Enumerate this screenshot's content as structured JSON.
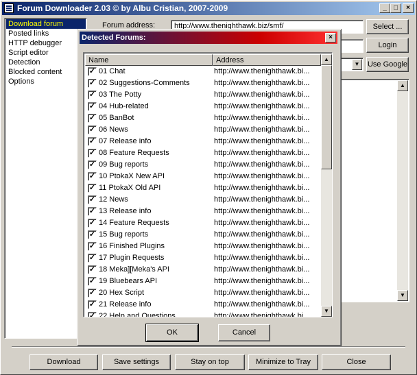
{
  "window": {
    "title": "Forum Downloader 2.03 © by Albu Cristian, 2007-2009",
    "controls": {
      "minimize": "_",
      "maximize": "□",
      "close": "×"
    }
  },
  "nav": {
    "items": [
      {
        "label": "Download forum",
        "selected": true
      },
      {
        "label": "Posted links"
      },
      {
        "label": "HTTP debugger"
      },
      {
        "label": "Script editor"
      },
      {
        "label": "Detection"
      },
      {
        "label": "Blocked content"
      },
      {
        "label": "Options"
      }
    ]
  },
  "main": {
    "forum_address_label": "Forum address:",
    "forum_address_value": "http://www.thenighthawk.biz/smf/",
    "select_button": "Select ...",
    "login_button": "Login",
    "use_google_button": "Use Google",
    "dropdown_arrow": "▼",
    "scroll_up": "▲",
    "scroll_down": "▼"
  },
  "dialog": {
    "title": "Detected Forums:",
    "close": "×",
    "col_name": "Name",
    "col_address": "Address",
    "check_mark": "✓",
    "rows": [
      {
        "name": "01 Chat",
        "address": "http://www.thenighthawk.bi..."
      },
      {
        "name": "02 Suggestions-Comments",
        "address": "http://www.thenighthawk.bi..."
      },
      {
        "name": "03 The Potty",
        "address": "http://www.thenighthawk.bi..."
      },
      {
        "name": "04 Hub-related",
        "address": "http://www.thenighthawk.bi..."
      },
      {
        "name": "05 BanBot",
        "address": "http://www.thenighthawk.bi..."
      },
      {
        "name": "06 News",
        "address": "http://www.thenighthawk.bi..."
      },
      {
        "name": "07 Release info",
        "address": "http://www.thenighthawk.bi..."
      },
      {
        "name": "08 Feature Requests",
        "address": "http://www.thenighthawk.bi..."
      },
      {
        "name": "09 Bug reports",
        "address": "http://www.thenighthawk.bi..."
      },
      {
        "name": "10 PtokaX New API",
        "address": "http://www.thenighthawk.bi..."
      },
      {
        "name": "11 PtokaX Old API",
        "address": "http://www.thenighthawk.bi..."
      },
      {
        "name": "12 News",
        "address": "http://www.thenighthawk.bi..."
      },
      {
        "name": "13 Release info",
        "address": "http://www.thenighthawk.bi..."
      },
      {
        "name": "14 Feature Requests",
        "address": "http://www.thenighthawk.bi..."
      },
      {
        "name": "15 Bug reports",
        "address": "http://www.thenighthawk.bi..."
      },
      {
        "name": "16 Finished Plugins",
        "address": "http://www.thenighthawk.bi..."
      },
      {
        "name": "17 Plugin Requests",
        "address": "http://www.thenighthawk.bi..."
      },
      {
        "name": "18 Meka][Meka's API",
        "address": "http://www.thenighthawk.bi..."
      },
      {
        "name": "19 Bluebears API",
        "address": "http://www.thenighthawk.bi..."
      },
      {
        "name": "20 Hex Script",
        "address": "http://www.thenighthawk.bi..."
      },
      {
        "name": "21 Release info",
        "address": "http://www.thenighthawk.bi..."
      },
      {
        "name": "22 Help and Questions",
        "address": "http://www.thenighthawk.bi..."
      }
    ],
    "ok_button": "OK",
    "cancel_button": "Cancel",
    "scroll_up": "▲",
    "scroll_down": "▼"
  },
  "footer": {
    "download": "Download",
    "save_settings": "Save settings",
    "stay_on_top": "Stay on top",
    "minimize_to_tray": "Minimize to Tray",
    "close": "Close"
  }
}
